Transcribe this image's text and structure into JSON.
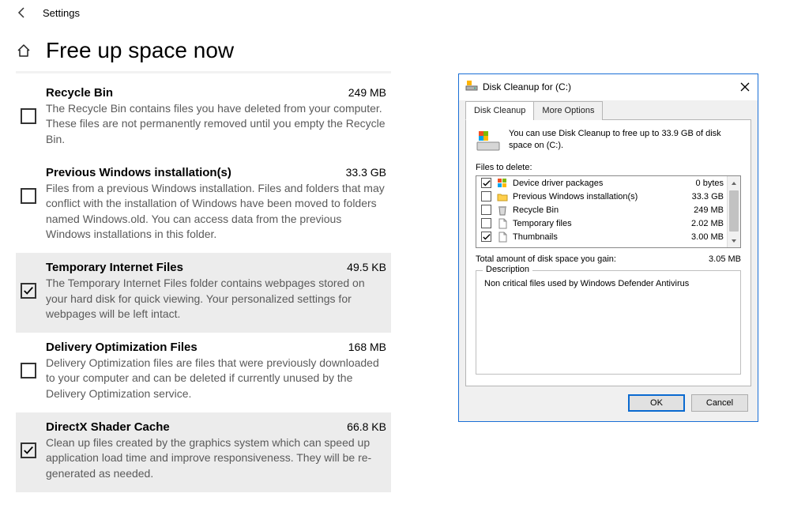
{
  "topbar": {
    "label": "Settings"
  },
  "page": {
    "title": "Free up space now"
  },
  "items": [
    {
      "checked": false,
      "selected": false,
      "title": "Recycle Bin",
      "size": "249 MB",
      "desc": "The Recycle Bin contains files you have deleted from your computer. These files are not permanently removed until you empty the Recycle Bin."
    },
    {
      "checked": false,
      "selected": false,
      "title": "Previous Windows installation(s)",
      "size": "33.3 GB",
      "desc": "Files from a previous Windows installation.  Files and folders that may conflict with the installation of Windows have been moved to folders named Windows.old.  You can access data from the previous Windows installations in this folder."
    },
    {
      "checked": true,
      "selected": true,
      "title": "Temporary Internet Files",
      "size": "49.5 KB",
      "desc": "The Temporary Internet Files folder contains webpages stored on your hard disk for quick viewing. Your personalized settings for webpages will be left intact."
    },
    {
      "checked": false,
      "selected": false,
      "title": "Delivery Optimization Files",
      "size": "168 MB",
      "desc": "Delivery Optimization files are files that were previously downloaded to your computer and can be deleted if currently unused by the Delivery Optimization service."
    },
    {
      "checked": true,
      "selected": true,
      "title": "DirectX Shader Cache",
      "size": "66.8 KB",
      "desc": "Clean up files created by the graphics system which can speed up application load time and improve responsiveness. They will be re-generated as needed."
    }
  ],
  "dialog": {
    "title": "Disk Cleanup for  (C:)",
    "tabs": {
      "cleanup": "Disk Cleanup",
      "more": "More Options"
    },
    "summary": "You can use Disk Cleanup to free up to 33.9 GB of disk space on  (C:).",
    "files_label": "Files to delete:",
    "files": [
      {
        "checked": true,
        "icon": "windows",
        "name": "Device driver packages",
        "size": "0 bytes"
      },
      {
        "checked": false,
        "icon": "folder",
        "name": "Previous Windows installation(s)",
        "size": "33.3 GB"
      },
      {
        "checked": false,
        "icon": "bin",
        "name": "Recycle Bin",
        "size": "249 MB"
      },
      {
        "checked": false,
        "icon": "file",
        "name": "Temporary files",
        "size": "2.02 MB"
      },
      {
        "checked": true,
        "icon": "file",
        "name": "Thumbnails",
        "size": "3.00 MB"
      }
    ],
    "total_label": "Total amount of disk space you gain:",
    "total_value": "3.05 MB",
    "desc_title": "Description",
    "desc_body": "Non critical files used by Windows Defender Antivirus",
    "ok": "OK",
    "cancel": "Cancel"
  }
}
